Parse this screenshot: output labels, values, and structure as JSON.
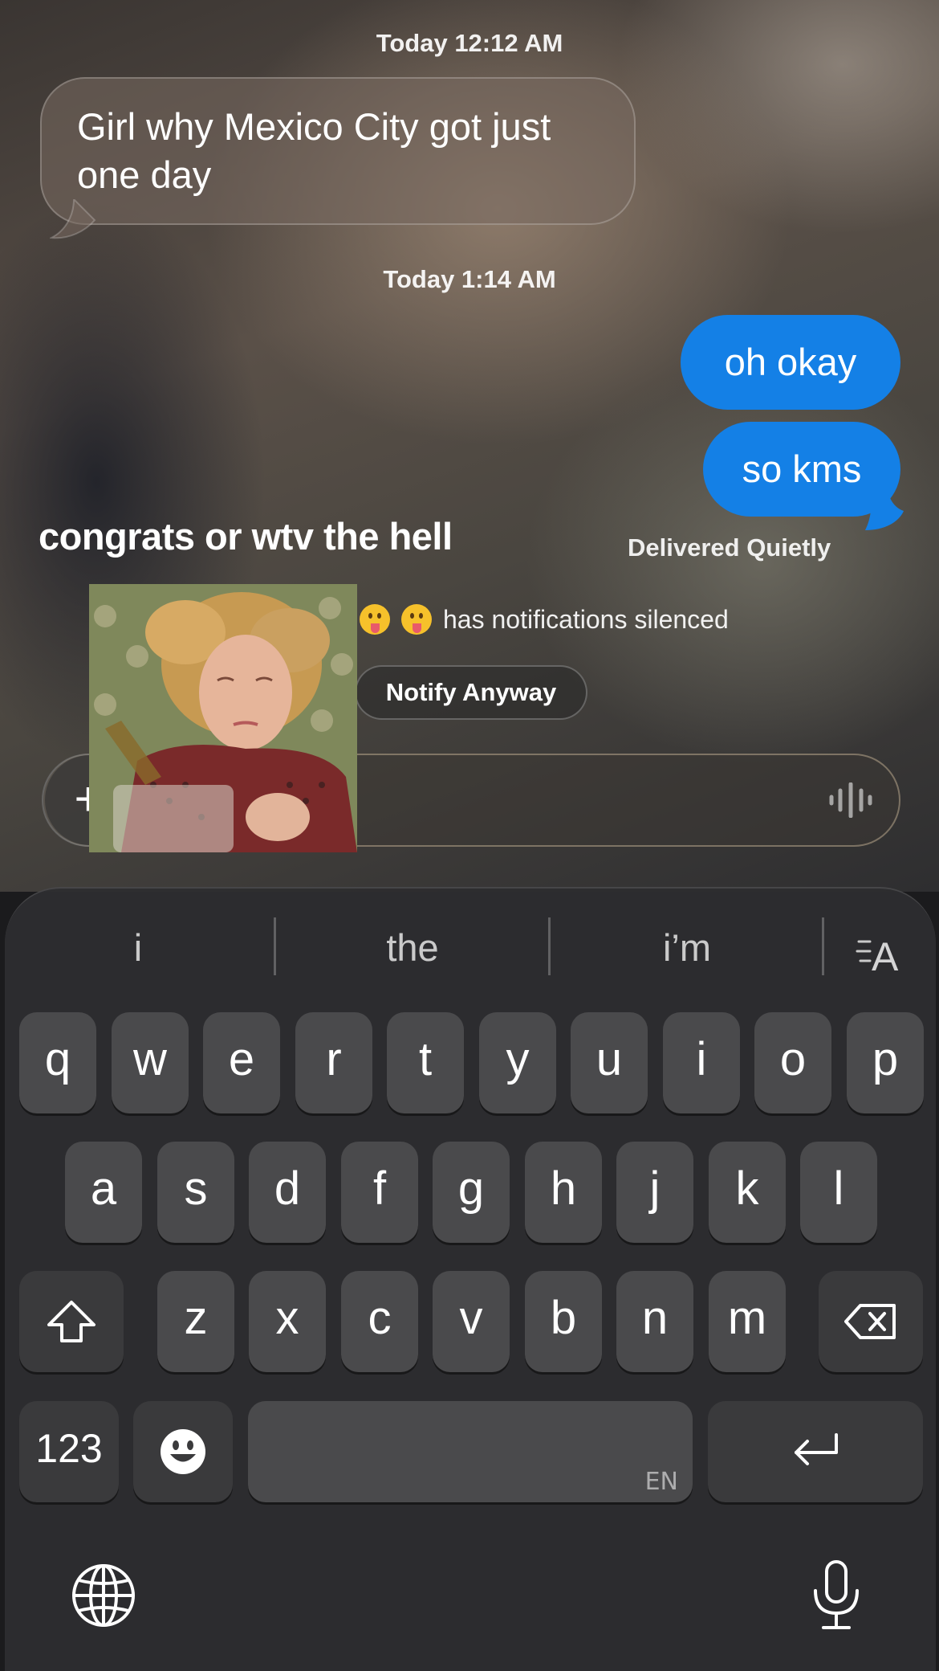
{
  "timestamps": {
    "first": "Today 12:12 AM",
    "second": "Today 1:14 AM"
  },
  "messages": {
    "incoming_1": "Girl why Mexico City got just one day",
    "outgoing_1": "oh okay",
    "outgoing_2": "so kms"
  },
  "caption": "congrats or wtv the hell",
  "status": {
    "delivered": "Delivered Quietly",
    "silenced": "has notifications silenced",
    "notify_button": "Notify Anyway"
  },
  "input": {
    "plus_label": "+",
    "voice_icon": "waveform-icon"
  },
  "keyboard": {
    "suggestions": [
      "i",
      "the",
      "i’m"
    ],
    "format_icon": "text-format-icon",
    "row1": [
      "q",
      "w",
      "e",
      "r",
      "t",
      "y",
      "u",
      "i",
      "o",
      "p"
    ],
    "row2": [
      "a",
      "s",
      "d",
      "f",
      "g",
      "h",
      "j",
      "k",
      "l"
    ],
    "row3": [
      "z",
      "x",
      "c",
      "v",
      "b",
      "n",
      "m"
    ],
    "numbers_label": "123",
    "space_lang": "EN",
    "globe_icon": "globe-icon",
    "mic_icon": "microphone-icon"
  },
  "colors": {
    "outgoing_bubble": "#1480e6",
    "key_background": "#4a4a4c",
    "keyboard_background": "#2d2d2f"
  }
}
